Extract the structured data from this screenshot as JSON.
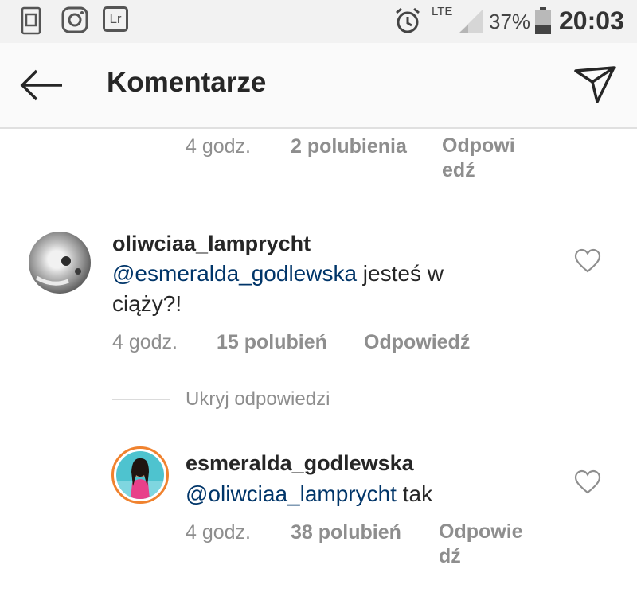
{
  "status_bar": {
    "network": "LTE",
    "battery": "37%",
    "time": "20:03",
    "battery_level": 0.37,
    "icons": [
      "clipboard-icon",
      "instagram-icon",
      "lightroom-icon",
      "alarm-icon",
      "signal-icon",
      "battery-icon"
    ],
    "lightroom_label": "Lr"
  },
  "header": {
    "title": "Komentarze",
    "icons": [
      "back-arrow-icon",
      "send-direct-icon"
    ]
  },
  "comments": [
    {
      "time": "4 godz.",
      "likes": "2 polubienia",
      "reply_line1": "Odpowi",
      "reply_line2": "edź"
    },
    {
      "username": "oliwciaa_lamprycht",
      "mention": "@esmeralda_godlewska",
      "text_part1": " jesteś w",
      "text_part2": "ciąży?!",
      "time": "4 godz.",
      "likes": "15 polubień",
      "reply": "Odpowiedź"
    },
    {
      "username": "esmeralda_godlewska",
      "mention": "@oliwciaa_lamprycht",
      "text": " tak",
      "time": "4 godz.",
      "likes": "38 polubień",
      "reply_line1": "Odpowie",
      "reply_line2": "dź"
    }
  ],
  "hide_replies": "Ukryj odpowiedzi",
  "colors": {
    "mention": "#003569",
    "muted": "#8e8e8e",
    "text": "#262626",
    "story_ring": "#f0822e"
  }
}
